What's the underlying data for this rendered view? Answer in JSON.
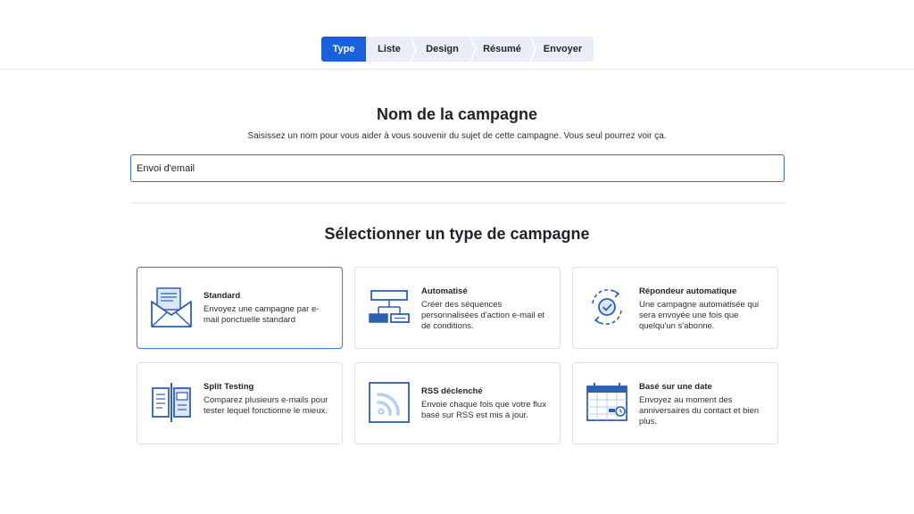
{
  "steps": [
    {
      "label": "Type"
    },
    {
      "label": "Liste"
    },
    {
      "label": "Design"
    },
    {
      "label": "Résumé"
    },
    {
      "label": "Envoyer"
    }
  ],
  "campaign_name": {
    "title": "Nom de la campagne",
    "subtitle": "Saisissez un nom pour vous aider à vous souvenir du sujet de cette campagne. Vous seul pourrez voir ça.",
    "value": "Envoi d'email"
  },
  "campaign_type": {
    "title": "Sélectionner un type de campagne",
    "cards": [
      {
        "title": "Standard",
        "description": "Envoyez une campagne par e-mail ponctuelle standard",
        "icon": "envelope-icon"
      },
      {
        "title": "Automatisé",
        "description": "Créer des séquences personnalisées d'action e-mail et de conditions.",
        "icon": "flowchart-icon"
      },
      {
        "title": "Répondeur automatique",
        "description": "Une campagne automatisée qui sera envoyée une fois que quelqu'un s'abonne.",
        "icon": "auto-check-icon"
      },
      {
        "title": "Split Testing",
        "description": "Comparez plusieurs e-mails pour tester lequel fonctionne le mieux.",
        "icon": "split-document-icon"
      },
      {
        "title": "RSS déclenché",
        "description": "Envoie chaque fois que votre flux basé sur RSS est mis à jour.",
        "icon": "rss-icon"
      },
      {
        "title": "Basé sur une date",
        "description": "Envoyez au moment des anniversaires du contact et bien plus.",
        "icon": "calendar-icon"
      }
    ]
  },
  "colors": {
    "accent": "#1a5fe0",
    "icon_blue": "#2f5fb3",
    "icon_light": "#dbe6f7"
  }
}
